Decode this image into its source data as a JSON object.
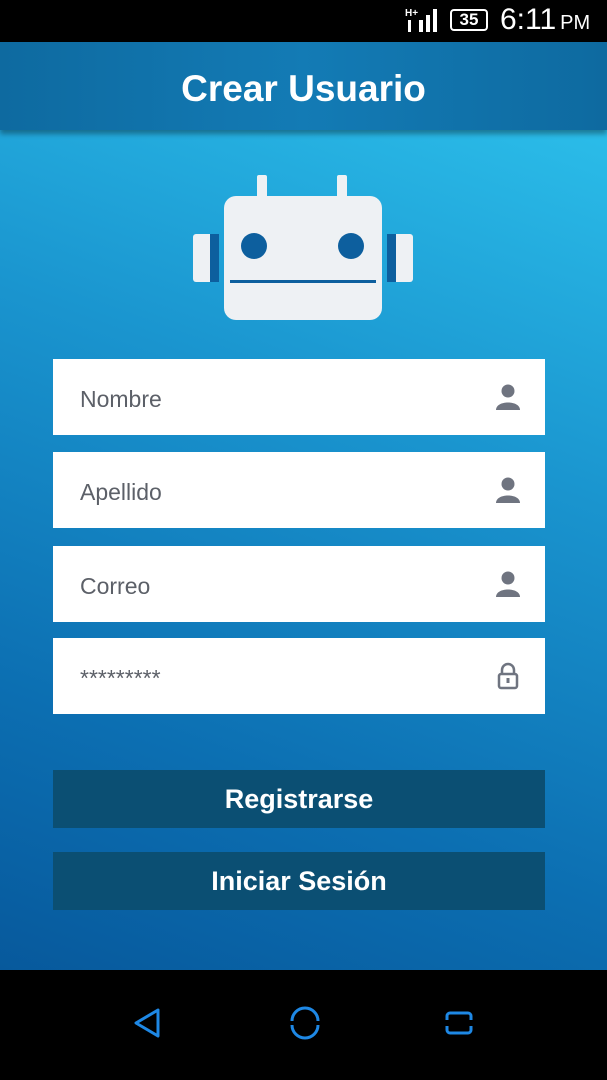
{
  "status_bar": {
    "network": "H+",
    "battery": "35",
    "time": "6:11",
    "ampm": "PM"
  },
  "app_bar": {
    "title": "Crear Usuario"
  },
  "form": {
    "fields": [
      {
        "value": "Nombre",
        "icon": "user-icon"
      },
      {
        "value": "Apellido",
        "icon": "user-icon"
      },
      {
        "value": "Correo",
        "icon": "user-icon"
      },
      {
        "value": "*********",
        "icon": "lock-icon"
      }
    ]
  },
  "buttons": {
    "register": "Registrarse",
    "login": "Iniciar Sesión"
  },
  "nav_bar": {
    "icons": [
      "back-icon",
      "home-icon",
      "recents-icon"
    ],
    "accent": "#1e88e5"
  },
  "colors": {
    "gradient_top": "#2fc6ef",
    "gradient_bottom": "#07599c",
    "app_bar": "#137bb5",
    "button": "#0b4f73",
    "robot_eye": "#0d5f9e"
  }
}
